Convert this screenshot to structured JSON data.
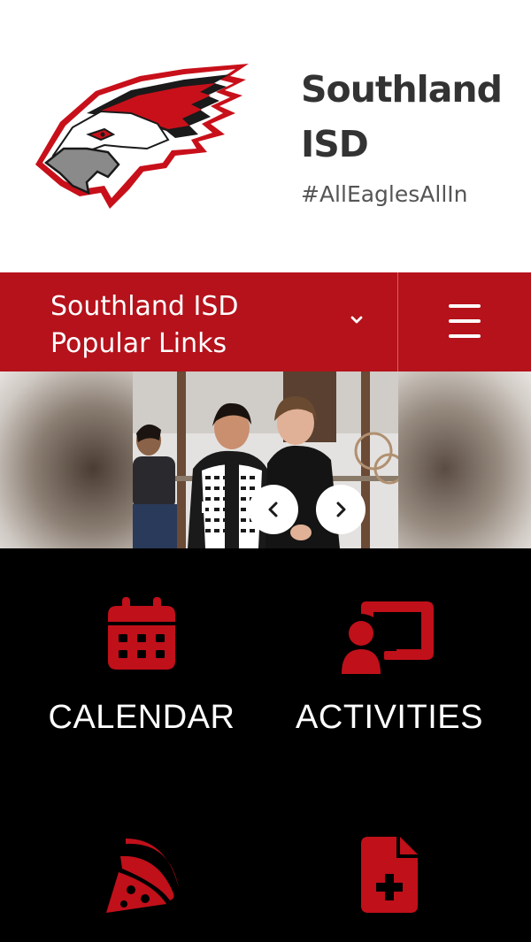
{
  "header": {
    "title": "Southland ISD",
    "tagline": "#AllEaglesAllIn"
  },
  "nav": {
    "popular_links_label": "Southland ISD Popular Links"
  },
  "slideshow": {
    "controls": [
      "pause-icon",
      "chevron-left-icon",
      "chevron-right-icon"
    ]
  },
  "quick_links": [
    {
      "label": "CALENDAR",
      "icon": "calendar-icon"
    },
    {
      "label": "ACTIVITIES",
      "icon": "presentation-icon"
    },
    {
      "label": "",
      "icon": "pizza-icon"
    },
    {
      "label": "",
      "icon": "file-plus-icon"
    }
  ],
  "colors": {
    "brand_red": "#b5121b",
    "icon_red": "#c0101a",
    "black": "#000000",
    "title_gray": "#333333"
  }
}
